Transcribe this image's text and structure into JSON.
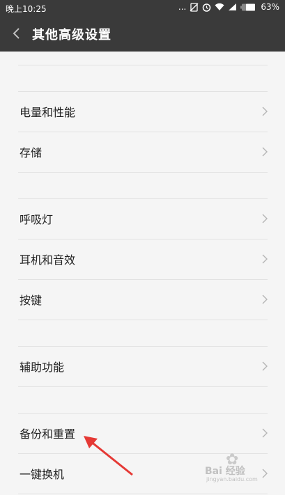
{
  "status_bar": {
    "time": "晚上10:25",
    "icons": [
      "more-dots-icon",
      "no-sim-icon",
      "alarm-icon",
      "wifi-icon",
      "signal-icon",
      "battery-icon"
    ],
    "dots": "...",
    "battery": "63%"
  },
  "header": {
    "title": "其他高级设置",
    "back_icon": "chevron-left-icon"
  },
  "groups": [
    {
      "items": [
        {
          "label": "电量和性能"
        },
        {
          "label": "存储"
        }
      ]
    },
    {
      "items": [
        {
          "label": "呼吸灯"
        },
        {
          "label": "耳机和音效"
        },
        {
          "label": "按键"
        }
      ]
    },
    {
      "items": [
        {
          "label": "辅助功能"
        }
      ]
    },
    {
      "items": [
        {
          "label": "备份和重置"
        },
        {
          "label": "一键换机"
        }
      ]
    }
  ],
  "annotation": {
    "arrow_color": "#e53935"
  },
  "watermark": {
    "text": "Bai 经验",
    "url": "jingyan.baidu.com"
  },
  "colors": {
    "bar": "#3a3a3a",
    "background": "#f5f5f5",
    "text": "#222222",
    "divider": "#e2e2e2",
    "chevron": "#b5b5b5"
  }
}
